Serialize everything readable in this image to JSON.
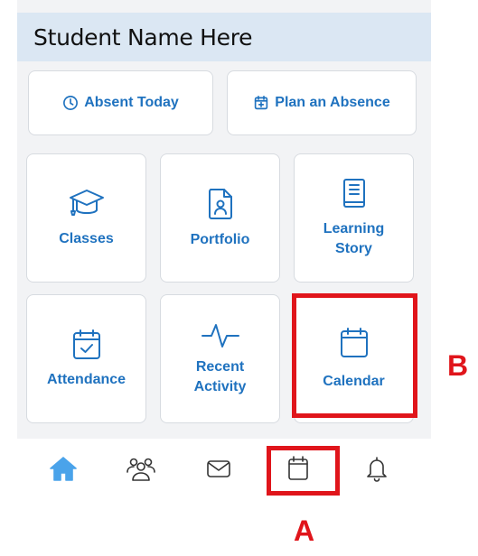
{
  "header": {
    "title": "Student Name Here"
  },
  "quick_actions": [
    {
      "label": "Absent Today",
      "icon": "clock-icon"
    },
    {
      "label": "Plan an Absence",
      "icon": "calendar-plus-icon"
    }
  ],
  "tiles": [
    {
      "label_lines": [
        "Classes"
      ],
      "icon": "graduation-cap-icon"
    },
    {
      "label_lines": [
        "Portfolio"
      ],
      "icon": "portfolio-document-icon"
    },
    {
      "label_lines": [
        "Learning",
        "Story"
      ],
      "icon": "book-icon"
    },
    {
      "label_lines": [
        "Attendance"
      ],
      "icon": "calendar-check-icon"
    },
    {
      "label_lines": [
        "Recent",
        "Activity"
      ],
      "icon": "activity-pulse-icon"
    },
    {
      "label_lines": [
        "Calendar"
      ],
      "icon": "calendar-icon"
    }
  ],
  "tabbar": [
    {
      "name": "home",
      "icon": "home-icon",
      "active": true
    },
    {
      "name": "people",
      "icon": "people-icon",
      "active": false
    },
    {
      "name": "messages",
      "icon": "mail-icon",
      "active": false
    },
    {
      "name": "calendar",
      "icon": "calendar-icon",
      "active": false
    },
    {
      "name": "notifications",
      "icon": "bell-icon",
      "active": false
    }
  ],
  "annotations": {
    "marker_a": "A",
    "marker_b": "B",
    "highlight_color": "#e0151b"
  },
  "colors": {
    "accent": "#1f72bf",
    "header_bg": "#dbe7f3",
    "background": "#f2f3f5",
    "home_active": "#4aa3ea"
  }
}
